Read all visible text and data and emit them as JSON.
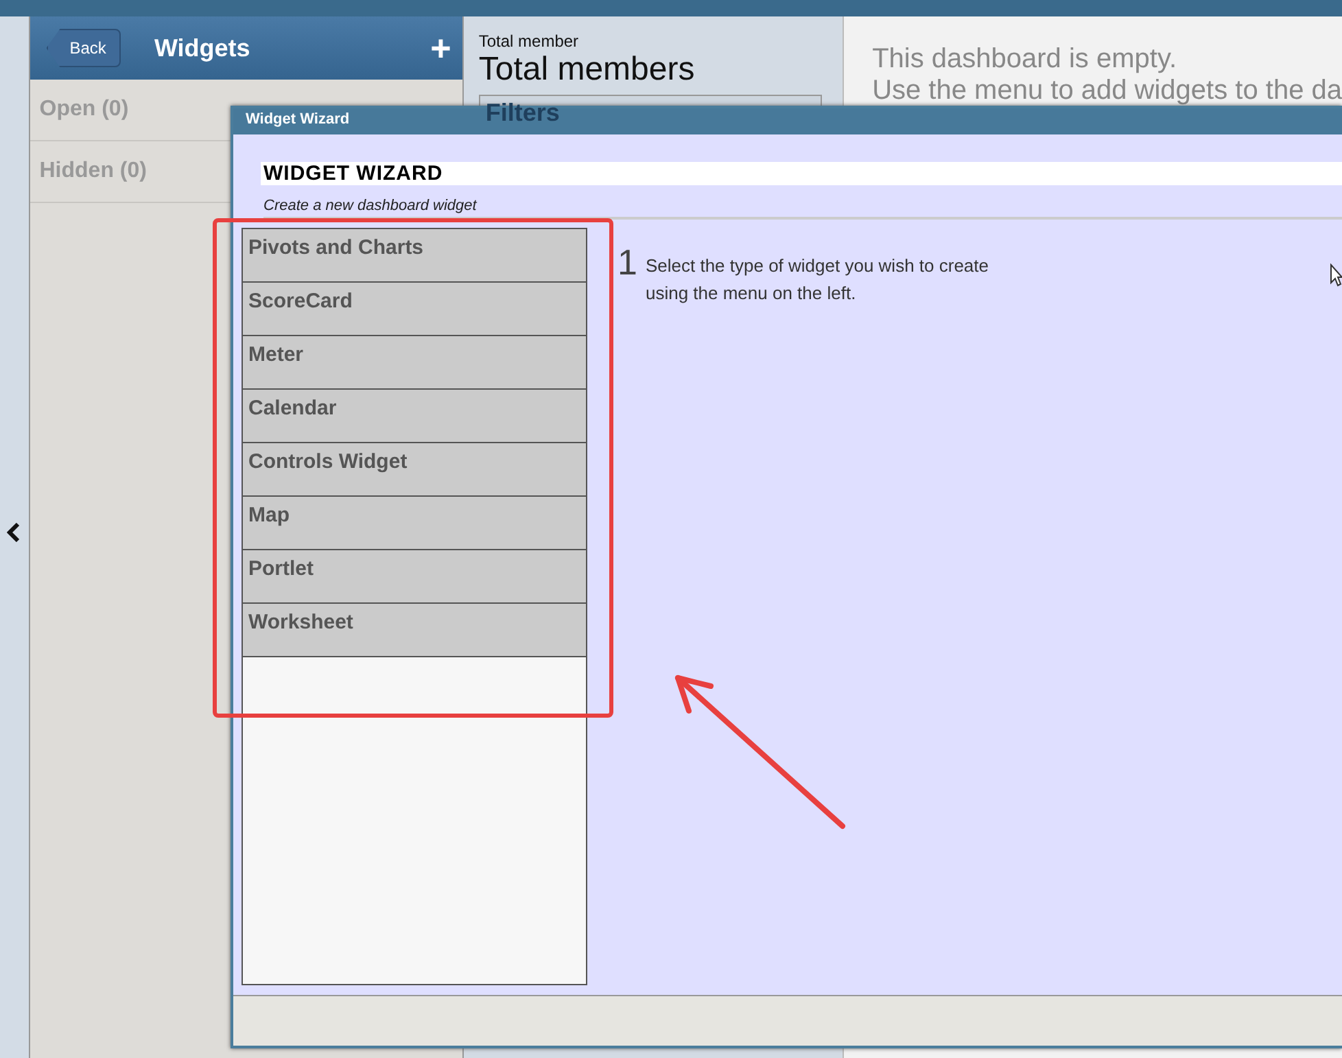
{
  "sidebar": {
    "back_button": "Back",
    "title": "Widgets",
    "add_button": "+",
    "items": [
      {
        "label": "Open (0)"
      },
      {
        "label": "Hidden (0)"
      }
    ]
  },
  "widget_panel": {
    "caption": "Total member",
    "title": "Total members",
    "filters_title": "Filters"
  },
  "dashboard": {
    "message_lines": [
      "This dashboard is empty.",
      "Use the menu to add widgets to the da"
    ]
  },
  "dialog": {
    "title": "Widget Wizard",
    "heading": "WIDGET WIZARD",
    "subtitle": "Create a new dashboard widget",
    "menu": [
      {
        "label": "Pivots and Charts"
      },
      {
        "label": "ScoreCard"
      },
      {
        "label": "Meter"
      },
      {
        "label": "Calendar"
      },
      {
        "label": "Controls Widget"
      },
      {
        "label": "Map"
      },
      {
        "label": "Portlet"
      },
      {
        "label": "Worksheet"
      }
    ],
    "step_number": "1",
    "instructions": "Select the type of widget you wish to create using the menu on the left."
  }
}
